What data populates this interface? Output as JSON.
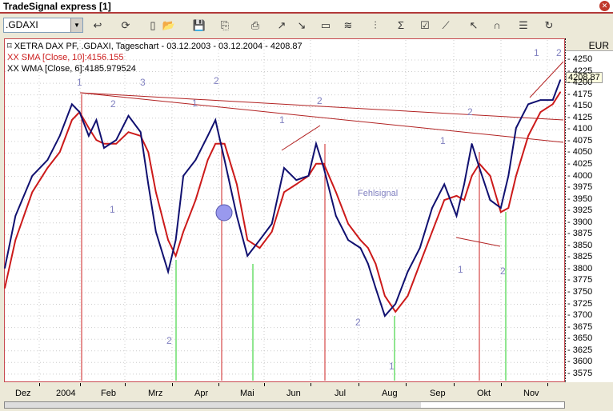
{
  "window": {
    "title": "TradeSignal express [1]",
    "close_icon": "close-icon"
  },
  "toolbar": {
    "symbol": ".GDAXI",
    "icons": [
      "refresh-icon",
      "reload-icon",
      "new-icon",
      "open-icon",
      "save-icon",
      "copy-icon",
      "print-icon",
      "chart-left-icon",
      "chart-right-icon",
      "window-icon",
      "indicator-icon",
      "candles-icon",
      "sigma-icon",
      "properties-icon",
      "draw-line-icon",
      "pointer-icon",
      "magnet-icon",
      "notes-icon",
      "undo-icon"
    ]
  },
  "legend": {
    "main": "XETRA DAX PF, .GDAXI, Tageschart - 03.12.2003 - 03.12.2004 - 4208.87",
    "sma": "XX SMA [Close, 10]:4156.155",
    "wma": "XX WMA [Close, 6]:4185.979524"
  },
  "axis": {
    "currency": "EUR",
    "last_price": "4208.87"
  },
  "annotations": {
    "fehlsignal": "Fehlsignal",
    "labels": [
      "1",
      "2",
      "3",
      "1",
      "2",
      "2",
      "1",
      "1",
      "2",
      "1",
      "2",
      "1",
      "2",
      "1",
      "2",
      "1",
      "2"
    ]
  },
  "chart_data": {
    "type": "line",
    "ylim": [
      3575,
      4250
    ],
    "yticks": [
      4250,
      4225,
      4200,
      4175,
      4150,
      4125,
      4100,
      4075,
      4050,
      4025,
      4000,
      3975,
      3950,
      3925,
      3900,
      3875,
      3850,
      3825,
      3800,
      3775,
      3750,
      3725,
      3700,
      3675,
      3650,
      3625,
      3600,
      3575
    ],
    "xlabels": [
      "Dez",
      "2004",
      "Feb",
      "Mrz",
      "Apr",
      "Mai",
      "Jun",
      "Jul",
      "Aug",
      "Sep",
      "Okt",
      "Nov"
    ],
    "xrange": [
      "2003-12-03",
      "2004-12-03"
    ],
    "colors": {
      "sma": "#cc1a1a",
      "wma": "#101070",
      "up_line": "#cc2222",
      "green_line": "#22cc22"
    },
    "dates": [
      "2003-12-03",
      "2003-12-10",
      "2003-12-21",
      "2003-12-31",
      "2004-01-08",
      "2004-01-16",
      "2004-01-21",
      "2004-01-27",
      "2004-02-01",
      "2004-02-06",
      "2004-02-14",
      "2004-02-22",
      "2004-03-01",
      "2004-03-06",
      "2004-03-11",
      "2004-03-19",
      "2004-03-24",
      "2004-03-29",
      "2004-04-06",
      "2004-04-14",
      "2004-04-19",
      "2004-04-25",
      "2004-05-03",
      "2004-05-10",
      "2004-05-18",
      "2004-05-26",
      "2004-06-03",
      "2004-06-11",
      "2004-06-19",
      "2004-06-24",
      "2004-06-29",
      "2004-07-07",
      "2004-07-15",
      "2004-07-23",
      "2004-07-28",
      "2004-08-02",
      "2004-08-08",
      "2004-08-15",
      "2004-08-23",
      "2004-08-31",
      "2004-09-08",
      "2004-09-16",
      "2004-09-24",
      "2004-09-29",
      "2004-10-04",
      "2004-10-09",
      "2004-10-16",
      "2004-10-23",
      "2004-10-28",
      "2004-11-02",
      "2004-11-10",
      "2004-11-18",
      "2004-11-26",
      "2004-12-01"
    ],
    "series": [
      {
        "name": "XX WMA [Close, 6]",
        "values": [
          3803,
          3915,
          4001,
          4035,
          4087,
          4155,
          4138,
          4087,
          4121,
          4061,
          4078,
          4130,
          4095,
          3983,
          3881,
          3795,
          3863,
          4001,
          4035,
          4087,
          4121,
          4035,
          3915,
          3829,
          3863,
          3898,
          4018,
          3992,
          4001,
          4070,
          4018,
          3915,
          3863,
          3846,
          3812,
          3760,
          3700,
          3726,
          3795,
          3846,
          3932,
          3983,
          3915,
          3983,
          4070,
          4018,
          3949,
          3932,
          4001,
          4104,
          4155,
          4164,
          4164,
          4207
        ]
      },
      {
        "name": "XX SMA [Close, 10]",
        "values": [
          3760,
          3863,
          3966,
          4018,
          4052,
          4121,
          4138,
          4104,
          4078,
          4070,
          4070,
          4095,
          4087,
          4052,
          3966,
          3863,
          3829,
          3881,
          3949,
          4035,
          4070,
          4070,
          3983,
          3863,
          3846,
          3881,
          3966,
          3983,
          4001,
          4027,
          4027,
          3966,
          3898,
          3863,
          3846,
          3812,
          3743,
          3709,
          3743,
          3812,
          3881,
          3949,
          3958,
          3949,
          4001,
          4027,
          4001,
          3923,
          3932,
          4001,
          4087,
          4138,
          4155,
          4181
        ]
      }
    ]
  }
}
